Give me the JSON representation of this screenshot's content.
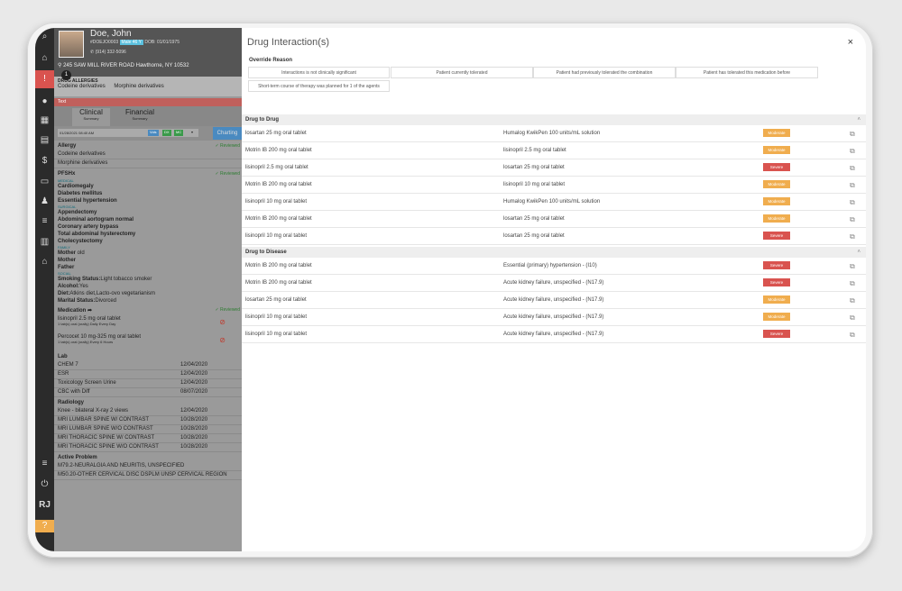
{
  "patient": {
    "name": "Doe, John",
    "id_line": "#DOEJO0003",
    "gender_age": "Male 46 Y",
    "dob": "DOB: 01/01/1975",
    "phone": "(914) 332-5096",
    "address": "245 SAW MILL RIVER ROAD Hawthorne, NY 10532"
  },
  "allergies_header": {
    "title": "DRUG ALLERGIES",
    "items": [
      "Codeine derivatives",
      "Morphine derivatives"
    ]
  },
  "alert_bar": "Text",
  "tabs": [
    {
      "label": "Clinical",
      "sub": "Summary"
    },
    {
      "label": "Financial",
      "sub": "Summary"
    }
  ],
  "date_field": "01/28/2021 08:40 AM",
  "date_buttons": [
    "Vols",
    "DX",
    "MC"
  ],
  "charting_label": "Charting",
  "allergy_section": {
    "title": "Allergy",
    "reviewed": "✓ Reviewed",
    "items": [
      "Codeine derivatives",
      "Morphine derivatives"
    ]
  },
  "pfsh": {
    "title": "PFSHx",
    "reviewed": "✓ Reviewed",
    "medical_label": "MEDICAL",
    "medical": [
      "Cardiomegaly",
      "Diabetes mellitus",
      "Essential hypertension"
    ],
    "surgical_label": "SURGICAL",
    "surgical": [
      "Appendectomy",
      "Abdominal aortogram normal",
      "Coronary artery bypass",
      "Total abdominal hysterectomy",
      "Cholecystectomy"
    ],
    "family_label": "FAMILY",
    "family": [
      {
        "b": "Mother",
        "t": " old"
      },
      {
        "b": "Mother",
        "t": ""
      },
      {
        "b": "Father",
        "t": ""
      }
    ],
    "social_label": "SOCIAL",
    "social": [
      {
        "b": "Smoking Status:",
        "t": "Light tobacco smoker"
      },
      {
        "b": "Alcohol:",
        "t": "Yes"
      },
      {
        "b": "Diet:",
        "t": "Atkins diet,Lacto-ovo vegetarianism"
      },
      {
        "b": "Marital Status:",
        "t": "Divorced"
      }
    ]
  },
  "medication": {
    "title": "Medication",
    "reviewed": "✓ Reviewed",
    "items": [
      {
        "name": "lisinopril 2.5 mg oral tablet",
        "sig": "1 tab(s) oral (orally) Daily Every Day"
      },
      {
        "name": "Percocet 10 mg-325 mg oral tablet",
        "sig": "1 tab(s) oral (orally) Every 6 Hours"
      }
    ]
  },
  "lab": {
    "title": "Lab",
    "items": [
      {
        "name": "CHEM 7",
        "date": "12/04/2020"
      },
      {
        "name": "ESR",
        "date": "12/04/2020"
      },
      {
        "name": "Toxicology Screen Urine",
        "date": "12/04/2020"
      },
      {
        "name": "CBC with Diff",
        "date": "08/07/2020"
      }
    ]
  },
  "radiology": {
    "title": "Radiology",
    "items": [
      {
        "name": "Knee - bilateral X-ray 2 views",
        "date": "12/04/2020"
      },
      {
        "name": "MRI LUMBAR SPINE W/ CONTRAST",
        "date": "10/28/2020"
      },
      {
        "name": "MRI LUMBAR SPINE W/O CONTRAST",
        "date": "10/28/2020"
      },
      {
        "name": "MRI THORACIC SPINE W/ CONTRAST",
        "date": "10/28/2020"
      },
      {
        "name": "MRI THORACIC SPINE W/O CONTRAST",
        "date": "10/28/2020"
      }
    ]
  },
  "active_problem": {
    "title": "Active Problem",
    "items": [
      "M79.2-NEURALGIA AND NEURITIS, UNSPECIFIED",
      "M50.20-OTHER CERVICAL DISC DSPLM UNSP CERVICAL REGION"
    ]
  },
  "rail": {
    "initials": "RJ",
    "badge": "1"
  },
  "modal": {
    "title": "Drug Interaction(s)",
    "close": "×",
    "override_label": "Override Reason",
    "override_options": [
      "Interactions is not clinically significant",
      "Patient currently tolerated",
      "Patient had previously tolerated the combination",
      "Patient has tolerated this medication before",
      "Short-term course of therapy was planned for 1 of the agents"
    ],
    "drug_to_drug_title": "Drug to Drug",
    "drug_to_drug": [
      {
        "a": "losartan 25 mg oral tablet",
        "b": "Humalog KwikPen 100 units/mL solution",
        "sev": "Moderate"
      },
      {
        "a": "Motrin IB 200 mg oral tablet",
        "b": "lisinopril 2.5 mg oral tablet",
        "sev": "Moderate"
      },
      {
        "a": "lisinopril 2.5 mg oral tablet",
        "b": "losartan 25 mg oral tablet",
        "sev": "Severe"
      },
      {
        "a": "Motrin IB 200 mg oral tablet",
        "b": "lisinopril 10 mg oral tablet",
        "sev": "Moderate"
      },
      {
        "a": "lisinopril 10 mg oral tablet",
        "b": "Humalog KwikPen 100 units/mL solution",
        "sev": "Moderate"
      },
      {
        "a": "Motrin IB 200 mg oral tablet",
        "b": "losartan 25 mg oral tablet",
        "sev": "Moderate"
      },
      {
        "a": "lisinopril 10 mg oral tablet",
        "b": "losartan 25 mg oral tablet",
        "sev": "Severe"
      }
    ],
    "drug_to_disease_title": "Drug to Disease",
    "drug_to_disease": [
      {
        "a": "Motrin IB 200 mg oral tablet",
        "b": "Essential (primary) hypertension - (I10)",
        "sev": "Severe"
      },
      {
        "a": "Motrin IB 200 mg oral tablet",
        "b": "Acute kidney failure, unspecified - (N17.9)",
        "sev": "Severe"
      },
      {
        "a": "losartan 25 mg oral tablet",
        "b": "Acute kidney failure, unspecified - (N17.9)",
        "sev": "Moderate"
      },
      {
        "a": "lisinopril 10 mg oral tablet",
        "b": "Acute kidney failure, unspecified - (N17.9)",
        "sev": "Moderate"
      },
      {
        "a": "lisinopril 10 mg oral tablet",
        "b": "Acute kidney failure, unspecified - (N17.9)",
        "sev": "Severe"
      }
    ]
  },
  "colors": {
    "moderate": "#f0ad4e",
    "severe": "#d9534f",
    "rail": "#2b2b2b"
  }
}
